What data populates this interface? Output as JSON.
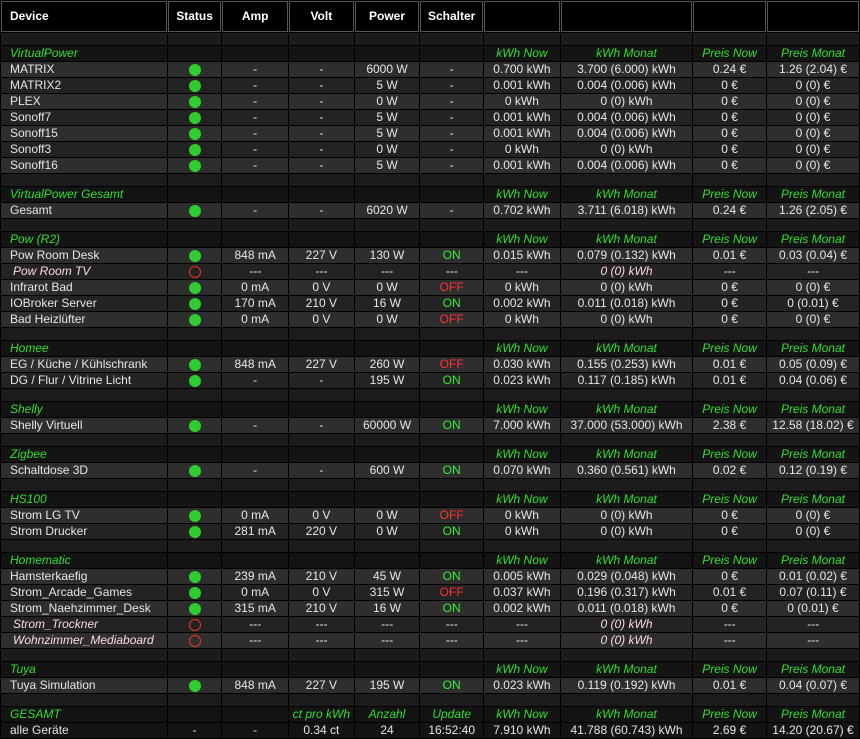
{
  "colors": {
    "green": "#33ee33",
    "red": "#ff3333",
    "status_green": "#2fcc2f",
    "status_red": "#ee3322"
  },
  "headers": [
    "Device",
    "Status",
    "Amp",
    "Volt",
    "Power",
    "Schalter",
    "",
    "",
    "",
    ""
  ],
  "section_headers": [
    "kWh Now",
    "kWh Monat",
    "Preis Now",
    "Preis Monat"
  ],
  "sections": [
    {
      "title": "VirtualPower",
      "rows": [
        {
          "name": "MATRIX",
          "status": "online",
          "amp": "-",
          "volt": "-",
          "power": "6000 W",
          "schalter": "-",
          "kwh_now": "0.700 kWh",
          "kwh_monat": "3.700 (6.000) kWh",
          "preis_now": "0.24 €",
          "preis_monat": "1.26 (2.04) €"
        },
        {
          "name": "MATRIX2",
          "status": "online",
          "amp": "-",
          "volt": "-",
          "power": "5 W",
          "schalter": "-",
          "kwh_now": "0.001 kWh",
          "kwh_monat": "0.004 (0.006) kWh",
          "preis_now": "0 €",
          "preis_monat": "0 (0) €"
        },
        {
          "name": "PLEX",
          "status": "online",
          "amp": "-",
          "volt": "-",
          "power": "0 W",
          "schalter": "-",
          "kwh_now": "0 kWh",
          "kwh_monat": "0 (0) kWh",
          "preis_now": "0 €",
          "preis_monat": "0 (0) €"
        },
        {
          "name": "Sonoff7",
          "status": "online",
          "amp": "-",
          "volt": "-",
          "power": "5 W",
          "schalter": "-",
          "kwh_now": "0.001 kWh",
          "kwh_monat": "0.004 (0.006) kWh",
          "preis_now": "0 €",
          "preis_monat": "0 (0) €"
        },
        {
          "name": "Sonoff15",
          "status": "online",
          "amp": "-",
          "volt": "-",
          "power": "5 W",
          "schalter": "-",
          "kwh_now": "0.001 kWh",
          "kwh_monat": "0.004 (0.006) kWh",
          "preis_now": "0 €",
          "preis_monat": "0 (0) €"
        },
        {
          "name": "Sonoff3",
          "status": "online",
          "amp": "-",
          "volt": "-",
          "power": "0 W",
          "schalter": "-",
          "kwh_now": "0 kWh",
          "kwh_monat": "0 (0) kWh",
          "preis_now": "0 €",
          "preis_monat": "0 (0) €"
        },
        {
          "name": "Sonoff16",
          "status": "online",
          "amp": "-",
          "volt": "-",
          "power": "5 W",
          "schalter": "-",
          "kwh_now": "0.001 kWh",
          "kwh_monat": "0.004 (0.006) kWh",
          "preis_now": "0 €",
          "preis_monat": "0 (0) €"
        }
      ]
    },
    {
      "title": "VirtualPower Gesamt",
      "rows": [
        {
          "name": "Gesamt",
          "status": "online",
          "amp": "-",
          "volt": "-",
          "power": "6020 W",
          "schalter": "-",
          "kwh_now": "0.702 kWh",
          "kwh_monat": "3.711 (6.018) kWh",
          "preis_now": "0.24 €",
          "preis_monat": "1.26 (2.05) €"
        }
      ]
    },
    {
      "title": "Pow (R2)",
      "rows": [
        {
          "name": "Pow Room Desk",
          "status": "online",
          "amp": "848 mA",
          "volt": "227 V",
          "power": "130 W",
          "schalter": "ON",
          "kwh_now": "0.015 kWh",
          "kwh_monat": "0.079 (0.132) kWh",
          "preis_now": "0.01 €",
          "preis_monat": "0.03 (0.04) €"
        },
        {
          "name": "Pow Room TV",
          "status": "offline",
          "amp": "---",
          "volt": "---",
          "power": "---",
          "schalter": "---",
          "kwh_now": "---",
          "kwh_monat": "0 (0) kWh",
          "preis_now": "---",
          "preis_monat": "---"
        },
        {
          "name": "Infrarot Bad",
          "status": "online",
          "amp": "0 mA",
          "volt": "0 V",
          "power": "0 W",
          "schalter": "OFF",
          "kwh_now": "0 kWh",
          "kwh_monat": "0 (0) kWh",
          "preis_now": "0 €",
          "preis_monat": "0 (0) €"
        },
        {
          "name": "IOBroker Server",
          "status": "online",
          "amp": "170 mA",
          "volt": "210 V",
          "power": "16 W",
          "schalter": "ON",
          "kwh_now": "0.002 kWh",
          "kwh_monat": "0.011 (0.018) kWh",
          "preis_now": "0 €",
          "preis_monat": "0 (0.01) €"
        },
        {
          "name": "Bad Heizlüfter",
          "status": "online",
          "amp": "0 mA",
          "volt": "0 V",
          "power": "0 W",
          "schalter": "OFF",
          "kwh_now": "0 kWh",
          "kwh_monat": "0 (0) kWh",
          "preis_now": "0 €",
          "preis_monat": "0 (0) €"
        }
      ]
    },
    {
      "title": "Homee",
      "rows": [
        {
          "name": "EG / Küche / Kühlschrank",
          "status": "online",
          "amp": "848 mA",
          "volt": "227 V",
          "power": "260 W",
          "schalter": "OFF",
          "kwh_now": "0.030 kWh",
          "kwh_monat": "0.155 (0.253) kWh",
          "preis_now": "0.01 €",
          "preis_monat": "0.05 (0.09) €"
        },
        {
          "name": "DG / Flur / Vitrine Licht",
          "status": "online",
          "amp": "-",
          "volt": "-",
          "power": "195 W",
          "schalter": "ON",
          "kwh_now": "0.023 kWh",
          "kwh_monat": "0.117 (0.185) kWh",
          "preis_now": "0.01 €",
          "preis_monat": "0.04 (0.06) €"
        }
      ]
    },
    {
      "title": "Shelly",
      "rows": [
        {
          "name": "Shelly Virtuell",
          "status": "online",
          "amp": "-",
          "volt": "-",
          "power": "60000 W",
          "schalter": "ON",
          "kwh_now": "7.000 kWh",
          "kwh_monat": "37.000 (53.000) kWh",
          "preis_now": "2.38 €",
          "preis_monat": "12.58 (18.02) €"
        }
      ]
    },
    {
      "title": "Zigbee",
      "rows": [
        {
          "name": "Schaltdose 3D",
          "status": "online",
          "amp": "-",
          "volt": "-",
          "power": "600 W",
          "schalter": "ON",
          "kwh_now": "0.070 kWh",
          "kwh_monat": "0.360 (0.561) kWh",
          "preis_now": "0.02 €",
          "preis_monat": "0.12 (0.19) €"
        }
      ]
    },
    {
      "title": "HS100",
      "rows": [
        {
          "name": "Strom LG TV",
          "status": "online",
          "amp": "0 mA",
          "volt": "0 V",
          "power": "0 W",
          "schalter": "OFF",
          "kwh_now": "0 kWh",
          "kwh_monat": "0 (0) kWh",
          "preis_now": "0 €",
          "preis_monat": "0 (0) €"
        },
        {
          "name": "Strom Drucker",
          "status": "online",
          "amp": "281 mA",
          "volt": "220 V",
          "power": "0 W",
          "schalter": "ON",
          "kwh_now": "0 kWh",
          "kwh_monat": "0 (0) kWh",
          "preis_now": "0 €",
          "preis_monat": "0 (0) €"
        }
      ]
    },
    {
      "title": "Homematic",
      "rows": [
        {
          "name": "Hamsterkaefig",
          "status": "online",
          "amp": "239 mA",
          "volt": "210 V",
          "power": "45 W",
          "schalter": "ON",
          "kwh_now": "0.005 kWh",
          "kwh_monat": "0.029 (0.048) kWh",
          "preis_now": "0 €",
          "preis_monat": "0.01 (0.02) €"
        },
        {
          "name": "Strom_Arcade_Games",
          "status": "online",
          "amp": "0 mA",
          "volt": "0 V",
          "power": "315 W",
          "schalter": "OFF",
          "kwh_now": "0.037 kWh",
          "kwh_monat": "0.196 (0.317) kWh",
          "preis_now": "0.01 €",
          "preis_monat": "0.07 (0.11) €"
        },
        {
          "name": "Strom_Naehzimmer_Desk",
          "status": "online",
          "amp": "315 mA",
          "volt": "210 V",
          "power": "16 W",
          "schalter": "ON",
          "kwh_now": "0.002 kWh",
          "kwh_monat": "0.011 (0.018) kWh",
          "preis_now": "0 €",
          "preis_monat": "0 (0.01) €"
        },
        {
          "name": "Strom_Trockner",
          "status": "offline",
          "amp": "---",
          "volt": "---",
          "power": "---",
          "schalter": "---",
          "kwh_now": "---",
          "kwh_monat": "0 (0) kWh",
          "preis_now": "---",
          "preis_monat": "---"
        },
        {
          "name": "Wohnzimmer_Mediaboard",
          "status": "offline",
          "amp": "---",
          "volt": "---",
          "power": "---",
          "schalter": "---",
          "kwh_now": "---",
          "kwh_monat": "0 (0) kWh",
          "preis_now": "---",
          "preis_monat": "---"
        }
      ]
    },
    {
      "title": "Tuya",
      "rows": [
        {
          "name": "Tuya Simulation",
          "status": "online",
          "amp": "848 mA",
          "volt": "227 V",
          "power": "195 W",
          "schalter": "ON",
          "kwh_now": "0.023 kWh",
          "kwh_monat": "0.119 (0.192) kWh",
          "preis_now": "0.01 €",
          "preis_monat": "0.04 (0.07) €"
        }
      ]
    }
  ],
  "gesamt": {
    "title": "GESAMT",
    "headers": {
      "ct": "ct pro kWh",
      "anzahl": "Anzahl",
      "update": "Update",
      "kwh_now": "kWh Now",
      "kwh_monat": "kWh Monat",
      "preis_now": "Preis Now",
      "preis_monat": "Preis Monat"
    },
    "row": {
      "name": "alle Geräte",
      "status": "-",
      "amp": "-",
      "ct": "0.34 ct",
      "anzahl": "24",
      "update": "16:52:40",
      "kwh_now": "7.910 kWh",
      "kwh_monat": "41.788 (60.743) kWh",
      "preis_now": "2.69 €",
      "preis_monat": "14.20 (20.67) €"
    }
  }
}
